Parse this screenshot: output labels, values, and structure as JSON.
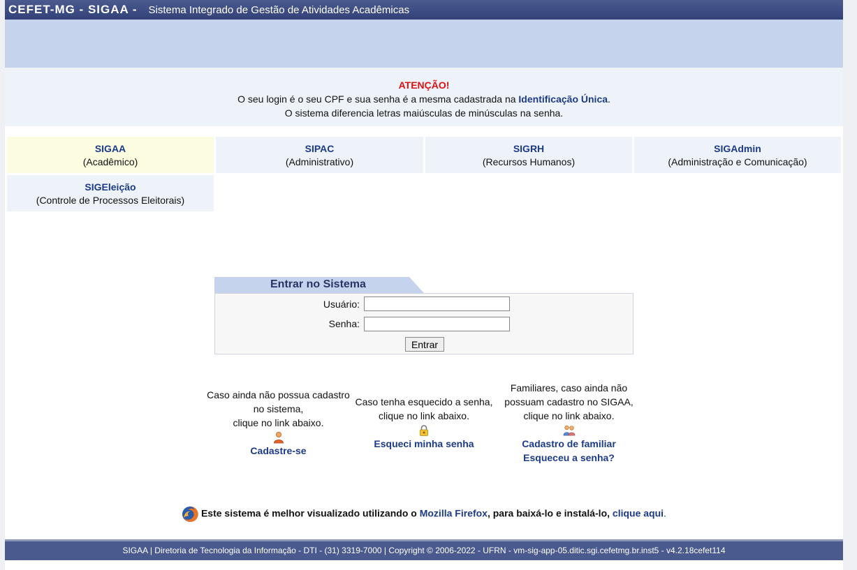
{
  "header": {
    "brand": "CEFET-MG - SIGAA -",
    "subtitle": "Sistema Integrado de Gestão de Atividades Acadêmicas"
  },
  "notice": {
    "title": "ATENÇÃO!",
    "line1_prefix": "O seu login é o seu CPF e sua senha é a mesma cadastrada na",
    "line1_link": "Identificação Única",
    "line1_suffix": ".",
    "line2": "O sistema diferencia letras maiúsculas de minúsculas na senha."
  },
  "systems": [
    {
      "name": "SIGAA",
      "desc": "(Acadêmico)"
    },
    {
      "name": "SIPAC",
      "desc": "(Administrativo)"
    },
    {
      "name": "SIGRH",
      "desc": "(Recursos Humanos)"
    },
    {
      "name": "SIGAdmin",
      "desc": "(Administração e Comunicação)"
    },
    {
      "name": "SIGEleição",
      "desc": "(Controle de Processos Eleitorais)"
    }
  ],
  "login": {
    "title": "Entrar no Sistema",
    "user_label": "Usuário:",
    "user_value": "",
    "password_label": "Senha:",
    "password_value": "",
    "submit": "Entrar"
  },
  "help": {
    "register": {
      "line1": "Caso ainda não possua cadastro",
      "line2": "no sistema,",
      "line3": "clique no link abaixo.",
      "link": "Cadastre-se",
      "icon": "user-add-icon"
    },
    "forgot": {
      "line1": "Caso tenha esquecido a senha,",
      "line2": "clique no link abaixo.",
      "link": "Esqueci minha senha",
      "icon": "lock-icon"
    },
    "family": {
      "line1": "Familiares, caso ainda não",
      "line2": "possuam cadastro no SIGAA,",
      "line3": "clique no link abaixo.",
      "link1": "Cadastro de familiar",
      "link2": "Esqueceu a senha?",
      "icon": "family-icon"
    }
  },
  "firefox": {
    "prefix": "Este sistema é melhor visualizado utilizando o",
    "link1": "Mozilla Firefox",
    "middle": ", para baixá-lo e instalá-lo,",
    "link2": "clique aqui",
    "suffix": ".",
    "icon": "firefox-icon"
  },
  "footer": {
    "text": "SIGAA | Diretoria de Tecnologia da Informação - DTI - (31) 3319-7000 | Copyright © 2006-2022 - UFRN - vm-sig-app-05.ditic.sgi.cefetmg.br.inst5 - v4.2.18cefet114"
  },
  "colors": {
    "header_bg": "#3b4a82",
    "band": "#c5d3ec",
    "link": "#1c3a8a",
    "alert": "#e01010"
  }
}
